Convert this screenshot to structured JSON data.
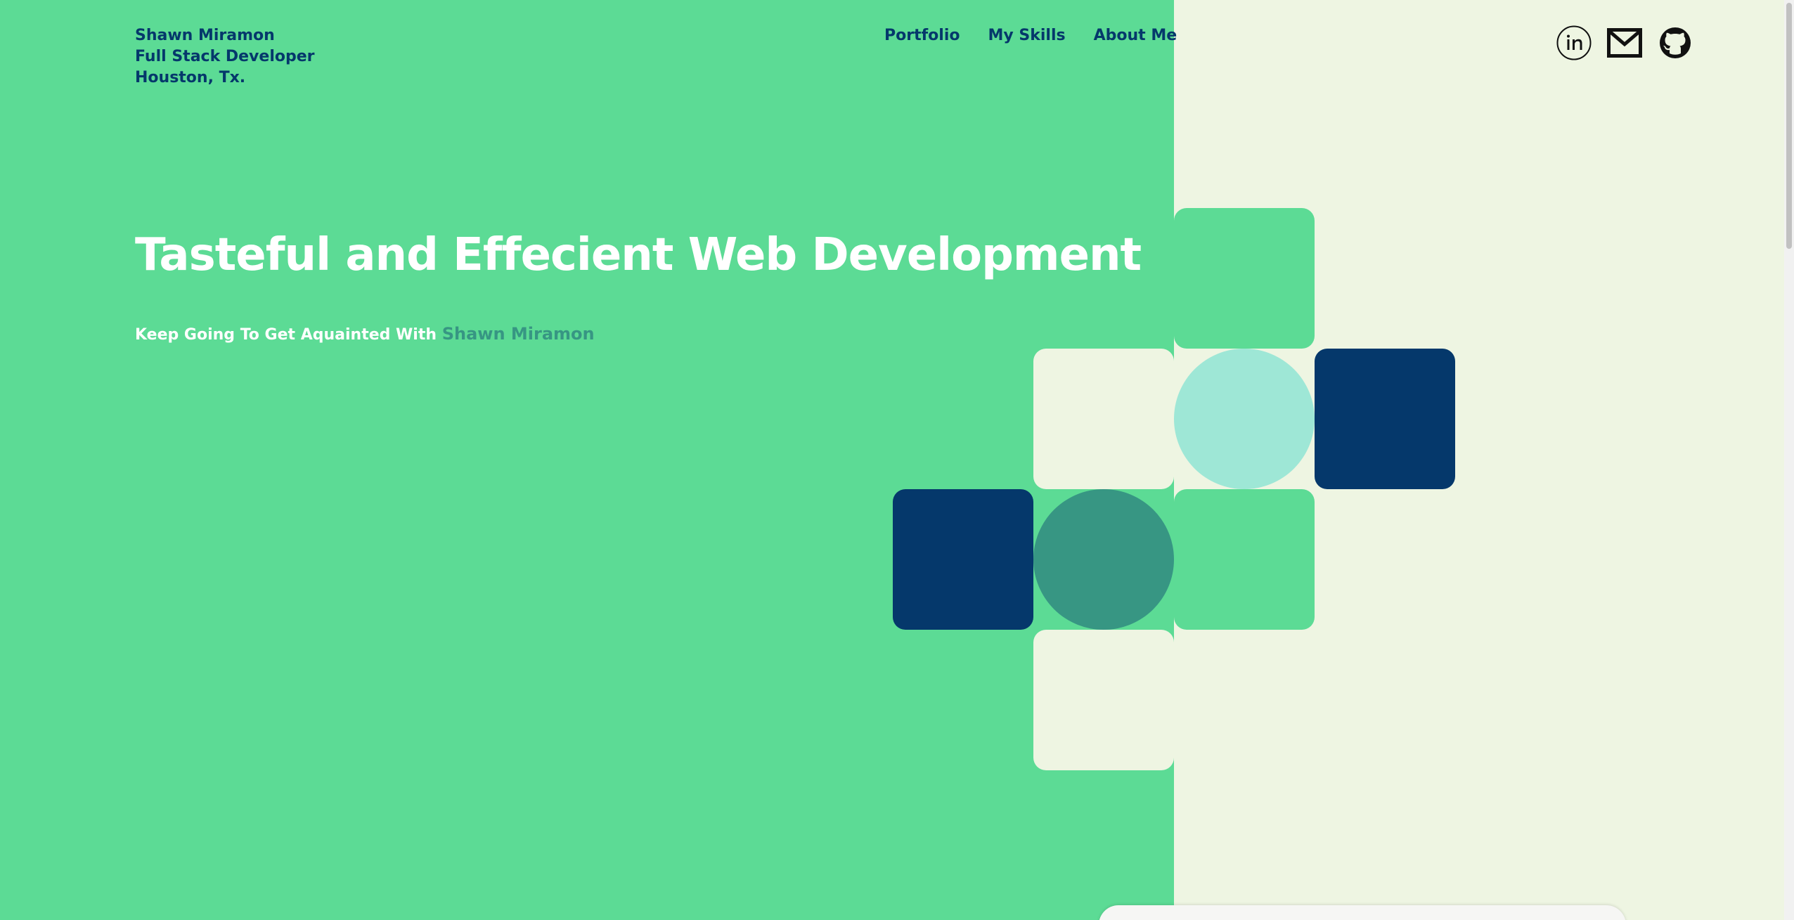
{
  "header": {
    "name": "Shawn Miramon",
    "role": "Full Stack Developer",
    "location": "Houston, Tx."
  },
  "nav": {
    "portfolio": "Portfolio",
    "skills": "My Skills",
    "about": "About Me"
  },
  "socials": [
    "linkedin-icon",
    "mail-icon",
    "github-icon"
  ],
  "hero": {
    "headline": "Tasteful and Effecient Web Development",
    "tagline_prefix": "Keep Going To Get Aquainted With",
    "tagline_name": "Shawn Miramon"
  },
  "colors": {
    "green": "#5cdb95",
    "cream": "#eef5e2",
    "navy": "#05386b",
    "mint": "#9ee7d6",
    "teal": "#379683"
  }
}
